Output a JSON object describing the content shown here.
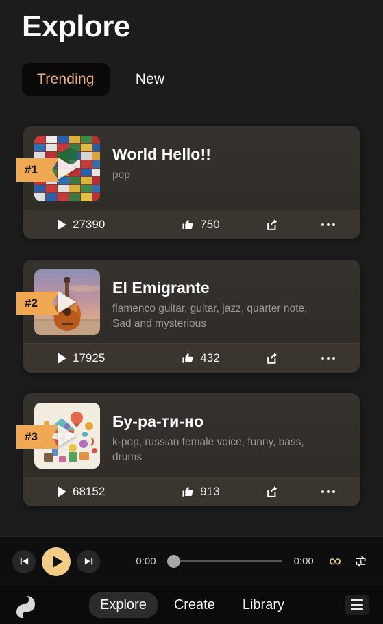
{
  "header": {
    "title": "Explore",
    "tabs": [
      {
        "label": "Trending",
        "active": true
      },
      {
        "label": "New",
        "active": false
      }
    ]
  },
  "colors": {
    "accent_gold": "#e4b27c",
    "badge_orange": "#f0a852",
    "play_button": "#f3cd85",
    "page_background": "#1c1c1c",
    "card_background": "#312e2a",
    "card_footer": "#3a352f"
  },
  "tracks": [
    {
      "rank": "#1",
      "title": "World Hello!!",
      "tags": "pop",
      "plays": "27390",
      "likes": "750",
      "artwork": "world-flags-collage",
      "play_icon": "play-icon",
      "like_icon": "thumbs-up-icon",
      "share_icon": "share-icon",
      "more_icon": "more-options-icon"
    },
    {
      "rank": "#2",
      "title": "El Emigrante",
      "tags": "flamenco guitar, guitar, jazz, quarter note,  Sad and mysterious",
      "plays": "17925",
      "likes": "432",
      "artwork": "acoustic-guitar-sunset",
      "play_icon": "play-icon",
      "like_icon": "thumbs-up-icon",
      "share_icon": "share-icon",
      "more_icon": "more-options-icon"
    },
    {
      "rank": "#3",
      "title": "Бу-ра-ти-но",
      "tags": "k-pop, russian female voice, funny, bass, drums",
      "plays": "68152",
      "likes": "913",
      "artwork": "colorful-doodle-illustration",
      "play_icon": "play-icon",
      "like_icon": "thumbs-up-icon",
      "share_icon": "share-icon",
      "more_icon": "more-options-icon"
    }
  ],
  "player": {
    "previous_icon": "skip-previous-icon",
    "play_icon": "play-icon",
    "next_icon": "skip-next-icon",
    "current_time": "0:00",
    "total_time": "0:00",
    "progress_percent": 0,
    "loop_icon": "infinity-icon",
    "loop_symbol": "∞",
    "repeat_icon": "repeat-one-icon"
  },
  "bottom_nav": {
    "logo_icon": "app-logo-icon",
    "items": [
      {
        "label": "Explore",
        "active": true
      },
      {
        "label": "Create",
        "active": false
      },
      {
        "label": "Library",
        "active": false
      }
    ],
    "menu_icon": "hamburger-menu-icon"
  }
}
